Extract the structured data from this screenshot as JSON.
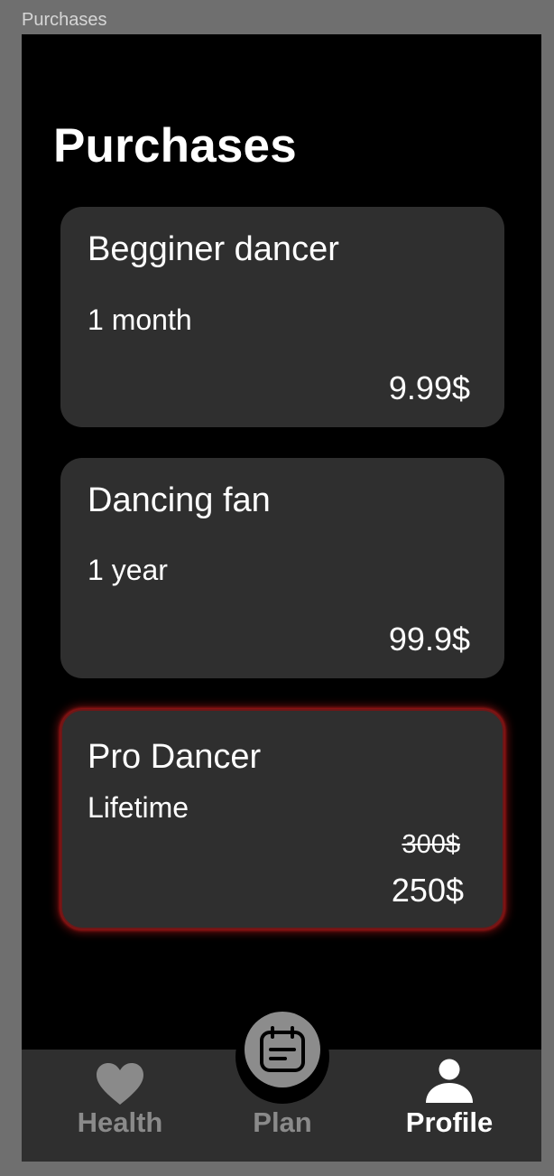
{
  "frame": {
    "label": "Purchases"
  },
  "header": {
    "title": "Purchases"
  },
  "plans": [
    {
      "name": "Begginer dancer",
      "term": "1 month",
      "price": "9.99$"
    },
    {
      "name": "Dancing fan",
      "term": "1 year",
      "price": "99.9$"
    },
    {
      "name": "Pro Dancer",
      "term": "Lifetime",
      "old_price": "300$",
      "price": "250$",
      "highlighted": true
    }
  ],
  "nav": {
    "items": [
      {
        "label": "Health",
        "icon": "heart-icon",
        "active": false
      },
      {
        "label": "Plan",
        "icon": "calendar-icon",
        "active": false
      },
      {
        "label": "Profile",
        "icon": "person-icon",
        "active": true
      }
    ]
  },
  "colors": {
    "background": "#000000",
    "card": "#2f2f2f",
    "highlight_glow": "#c81919",
    "nav_inactive": "#8a8a8a",
    "nav_active": "#ffffff"
  }
}
